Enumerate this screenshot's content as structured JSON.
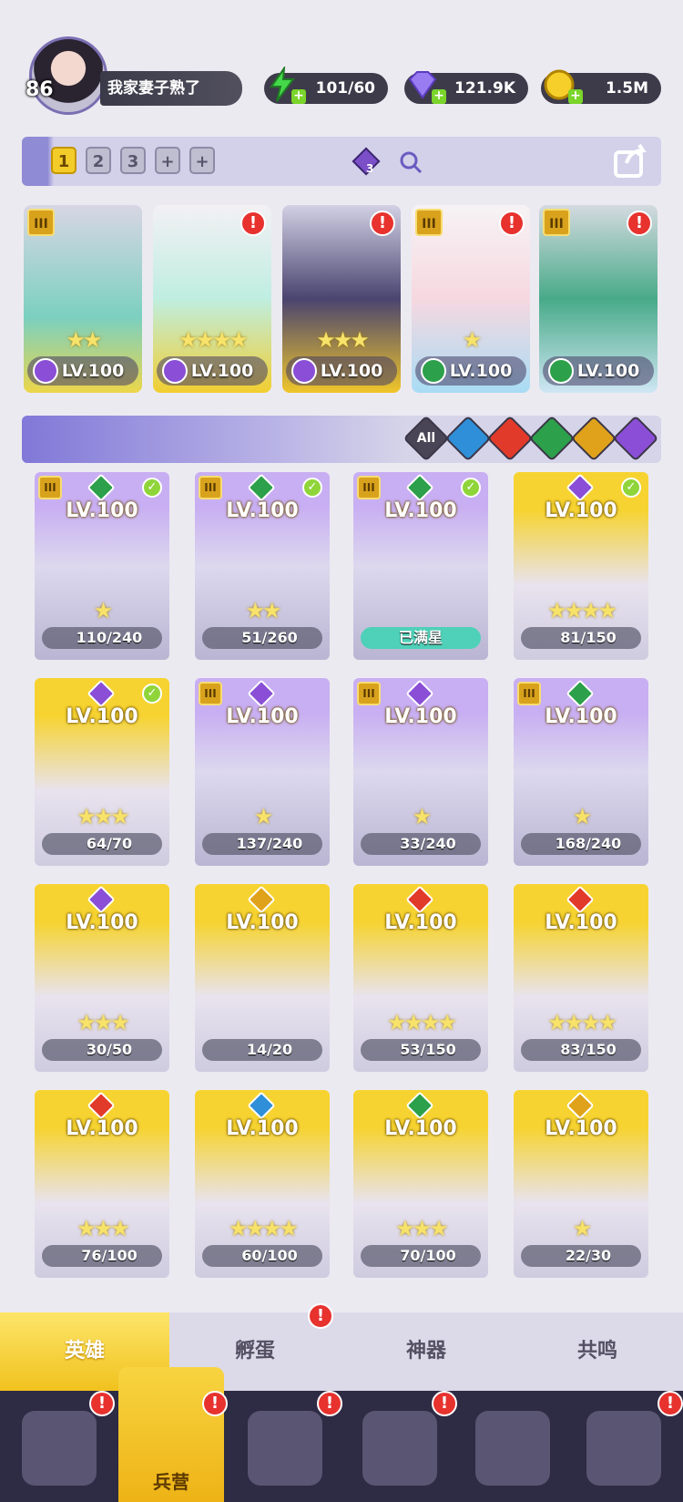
{
  "player": {
    "level": "86",
    "name": "我家妻子熟了"
  },
  "resources": {
    "energy": "101/60",
    "gems": "121.9K",
    "gold": "1.5M"
  },
  "teams": {
    "tabs": [
      "1",
      "2",
      "3",
      "+",
      "+"
    ],
    "count": "3"
  },
  "team": [
    {
      "lv": "LV.100",
      "stars": "★★",
      "element_color": "#8a4fd6",
      "tier": "III",
      "alert": false
    },
    {
      "lv": "LV.100",
      "stars": "★★★★",
      "element_color": "#8a4fd6",
      "tier": "",
      "alert": true
    },
    {
      "lv": "LV.100",
      "stars": "★★★",
      "element_color": "#8a4fd6",
      "tier": "",
      "alert": true
    },
    {
      "lv": "LV.100",
      "stars": "★",
      "element_color": "#2ca04a",
      "tier": "III",
      "alert": true
    },
    {
      "lv": "LV.100",
      "stars": "",
      "element_color": "#2ca04a",
      "tier": "III",
      "alert": true
    }
  ],
  "filters": {
    "all": "All"
  },
  "heroes": [
    {
      "lv": "LV.100",
      "shard": "110/240",
      "stars": "★",
      "style": "purple",
      "element_color": "#2ca04a",
      "tier": "III",
      "check": true
    },
    {
      "lv": "LV.100",
      "shard": "51/260",
      "stars": "★★",
      "style": "purple",
      "element_color": "#2ca04a",
      "tier": "III",
      "check": true
    },
    {
      "lv": "LV.100",
      "shard": "已满星",
      "stars": "",
      "style": "purple",
      "element_color": "#2ca04a",
      "tier": "III",
      "check": true
    },
    {
      "lv": "LV.100",
      "shard": "81/150",
      "stars": "★★★★",
      "style": "gold",
      "element_color": "#8a4fd6",
      "tier": "",
      "check": true
    },
    {
      "lv": "LV.100",
      "shard": "64/70",
      "stars": "★★★",
      "style": "gold",
      "element_color": "#8a4fd6",
      "tier": "",
      "check": true
    },
    {
      "lv": "LV.100",
      "shard": "137/240",
      "stars": "★",
      "style": "purple",
      "element_color": "#8a4fd6",
      "tier": "III",
      "check": false
    },
    {
      "lv": "LV.100",
      "shard": "33/240",
      "stars": "★",
      "style": "purple",
      "element_color": "#8a4fd6",
      "tier": "III",
      "check": false
    },
    {
      "lv": "LV.100",
      "shard": "168/240",
      "stars": "★",
      "style": "purple",
      "element_color": "#2ca04a",
      "tier": "III",
      "check": false
    },
    {
      "lv": "LV.100",
      "shard": "30/50",
      "stars": "★★★",
      "style": "gold",
      "element_color": "#8a4fd6",
      "tier": "",
      "check": false
    },
    {
      "lv": "LV.100",
      "shard": "14/20",
      "stars": "",
      "style": "gold",
      "element_color": "#e0a21a",
      "tier": "",
      "check": false
    },
    {
      "lv": "LV.100",
      "shard": "53/150",
      "stars": "★★★★",
      "style": "gold",
      "element_color": "#e23a2a",
      "tier": "",
      "check": false
    },
    {
      "lv": "LV.100",
      "shard": "83/150",
      "stars": "★★★★",
      "style": "gold",
      "element_color": "#e23a2a",
      "tier": "",
      "check": false
    },
    {
      "lv": "LV.100",
      "shard": "76/100",
      "stars": "★★★",
      "style": "gold",
      "element_color": "#e23a2a",
      "tier": "",
      "check": false
    },
    {
      "lv": "LV.100",
      "shard": "60/100",
      "stars": "★★★★",
      "style": "gold",
      "element_color": "#2f8fd8",
      "tier": "",
      "check": false
    },
    {
      "lv": "LV.100",
      "shard": "70/100",
      "stars": "★★★",
      "style": "gold",
      "element_color": "#2ca04a",
      "tier": "",
      "check": false
    },
    {
      "lv": "LV.100",
      "shard": "22/30",
      "stars": "★",
      "style": "gold",
      "element_color": "#e0a21a",
      "tier": "",
      "check": false
    }
  ],
  "subtabs": [
    "英雄",
    "孵蛋",
    "神器",
    "共鸣"
  ],
  "nav": {
    "active_label": "兵营"
  }
}
